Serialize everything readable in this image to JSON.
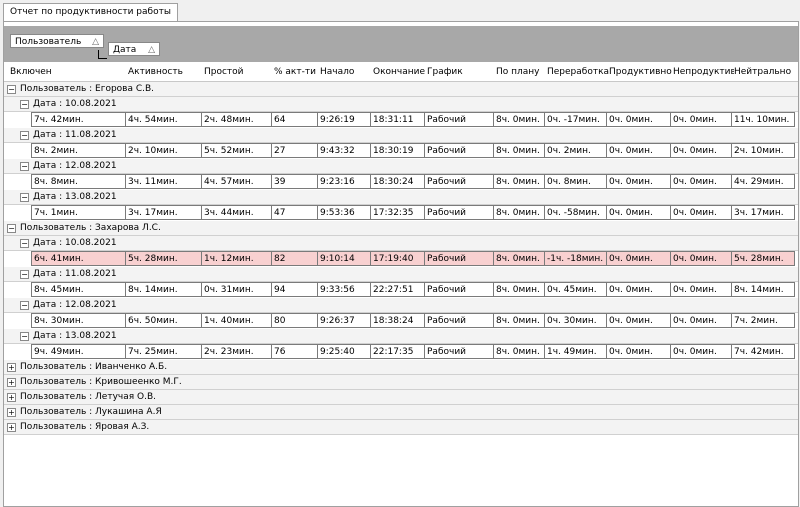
{
  "tab": {
    "label": "Отчет по продуктивности работы"
  },
  "grouping": {
    "user_label": "Пользователь",
    "date_label": "Дата",
    "sort_glyph": "△"
  },
  "columns": [
    "Включен",
    "Активность",
    "Простой",
    "% акт-ти",
    "Начало",
    "Окончание",
    "График",
    "По плану",
    "Переработка",
    "Продуктивно",
    "Непродуктивно",
    "Нейтрально"
  ],
  "expand_glyph": "⊟",
  "collapse_glyph": "⊞",
  "users": [
    {
      "label": "Пользователь : Егорова С.В.",
      "expanded": true,
      "dates": [
        {
          "label": "Дата : 10.08.2021",
          "highlight": false,
          "cells": [
            "7ч. 42мин.",
            "4ч. 54мин.",
            "2ч. 48мин.",
            "64",
            "9:26:19",
            "18:31:11",
            "Рабочий",
            "8ч. 0мин.",
            "0ч. -17мин.",
            "0ч. 0мин.",
            "0ч. 0мин.",
            "11ч. 10мин."
          ]
        },
        {
          "label": "Дата : 11.08.2021",
          "highlight": false,
          "cells": [
            "8ч. 2мин.",
            "2ч. 10мин.",
            "5ч. 52мин.",
            "27",
            "9:43:32",
            "18:30:19",
            "Рабочий",
            "8ч. 0мин.",
            "0ч. 2мин.",
            "0ч. 0мин.",
            "0ч. 0мин.",
            "2ч. 10мин."
          ]
        },
        {
          "label": "Дата : 12.08.2021",
          "highlight": false,
          "cells": [
            "8ч. 8мин.",
            "3ч. 11мин.",
            "4ч. 57мин.",
            "39",
            "9:23:16",
            "18:30:24",
            "Рабочий",
            "8ч. 0мин.",
            "0ч. 8мин.",
            "0ч. 0мин.",
            "0ч. 0мин.",
            "4ч. 29мин."
          ]
        },
        {
          "label": "Дата : 13.08.2021",
          "highlight": false,
          "cells": [
            "7ч. 1мин.",
            "3ч. 17мин.",
            "3ч. 44мин.",
            "47",
            "9:53:36",
            "17:32:35",
            "Рабочий",
            "8ч. 0мин.",
            "0ч. -58мин.",
            "0ч. 0мин.",
            "0ч. 0мин.",
            "3ч. 17мин."
          ]
        }
      ]
    },
    {
      "label": "Пользователь : Захарова Л.С.",
      "expanded": true,
      "dates": [
        {
          "label": "Дата : 10.08.2021",
          "highlight": true,
          "cells": [
            "6ч. 41мин.",
            "5ч. 28мин.",
            "1ч. 12мин.",
            "82",
            "9:10:14",
            "17:19:40",
            "Рабочий",
            "8ч. 0мин.",
            "-1ч. -18мин.",
            "0ч. 0мин.",
            "0ч. 0мин.",
            "5ч. 28мин."
          ]
        },
        {
          "label": "Дата : 11.08.2021",
          "highlight": false,
          "cells": [
            "8ч. 45мин.",
            "8ч. 14мин.",
            "0ч. 31мин.",
            "94",
            "9:33:56",
            "22:27:51",
            "Рабочий",
            "8ч. 0мин.",
            "0ч. 45мин.",
            "0ч. 0мин.",
            "0ч. 0мин.",
            "8ч. 14мин."
          ]
        },
        {
          "label": "Дата : 12.08.2021",
          "highlight": false,
          "cells": [
            "8ч. 30мин.",
            "6ч. 50мин.",
            "1ч. 40мин.",
            "80",
            "9:26:37",
            "18:38:24",
            "Рабочий",
            "8ч. 0мин.",
            "0ч. 30мин.",
            "0ч. 0мин.",
            "0ч. 0мин.",
            "7ч. 2мин."
          ]
        },
        {
          "label": "Дата : 13.08.2021",
          "highlight": false,
          "cells": [
            "9ч. 49мин.",
            "7ч. 25мин.",
            "2ч. 23мин.",
            "76",
            "9:25:40",
            "22:17:35",
            "Рабочий",
            "8ч. 0мин.",
            "1ч. 49мин.",
            "0ч. 0мин.",
            "0ч. 0мин.",
            "7ч. 42мин."
          ]
        }
      ]
    },
    {
      "label": "Пользователь : Иванченко А.Б.",
      "expanded": false,
      "dates": []
    },
    {
      "label": "Пользователь : Кривошеенко М.Г.",
      "expanded": false,
      "dates": []
    },
    {
      "label": "Пользователь : Летучая О.В.",
      "expanded": false,
      "dates": []
    },
    {
      "label": "Пользователь : Лукашина А.Я",
      "expanded": false,
      "dates": []
    },
    {
      "label": "Пользователь : Яровая А.З.",
      "expanded": false,
      "dates": []
    }
  ]
}
